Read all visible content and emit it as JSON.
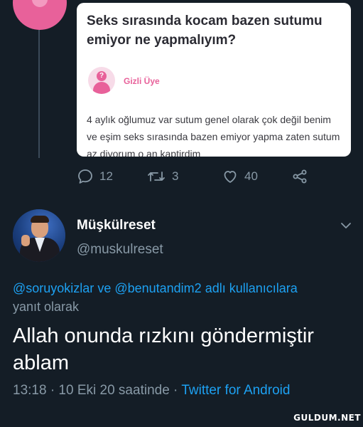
{
  "quoted_card": {
    "title": "Seks sırasında kocam bazen sutumu emiyor ne yapmalıyım?",
    "user": "Gizli Üye",
    "body": "4 aylık oğlumuz var sutum genel olarak çok değil benim ve eşim seks sırasında bazen emiyor yapma zaten sutum az diyorum o an kaptirdim"
  },
  "actions": {
    "reply_count": "12",
    "retweet_count": "3",
    "like_count": "40"
  },
  "tweet": {
    "display_name": "Müşkülreset",
    "handle": "@muskulreset",
    "reply_mention_1": "@soruyokizlar",
    "reply_joiner": " ve ",
    "reply_mention_2": "@benutandim2",
    "reply_suffix": " adlı kullanıcılara",
    "reply_second_line": "yanıt olarak",
    "text": "Allah onunda rızkını göndermiştir ablam",
    "timestamp": "13:18 · 10 Eki 20 saatinde · ",
    "source": "Twitter for Android"
  },
  "watermark": "GULDUM.NET",
  "colors": {
    "background": "#141d26",
    "accent": "#1da1f2",
    "muted": "#8899a6",
    "brand_pink": "#e8619a"
  },
  "icons": [
    "reply-icon",
    "retweet-icon",
    "like-icon",
    "share-icon",
    "chevron-down-icon"
  ]
}
